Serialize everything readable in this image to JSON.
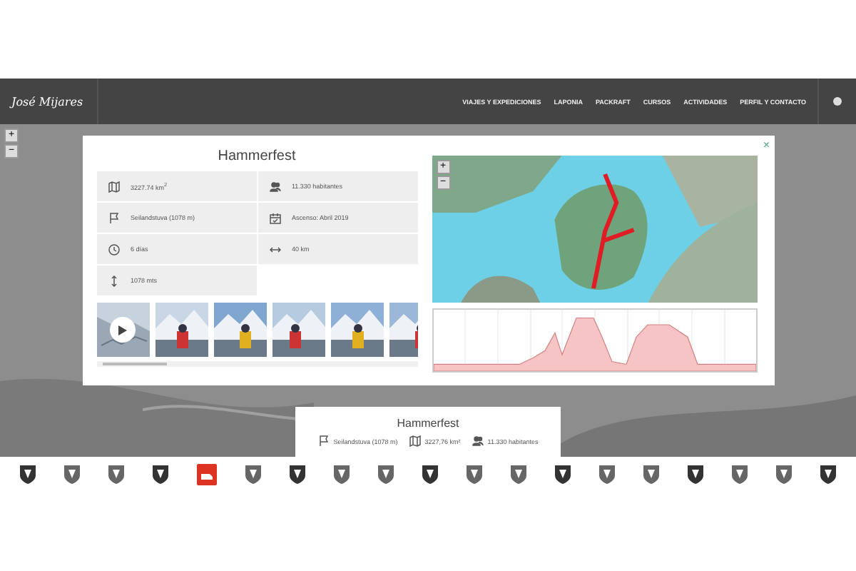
{
  "header": {
    "logo": "José Mijares",
    "nav": [
      {
        "label": "VIAJES Y EXPEDICIONES"
      },
      {
        "label": "LAPONIA"
      },
      {
        "label": "PACKRAFT"
      },
      {
        "label": "CURSOS"
      },
      {
        "label": "ACTIVIDADES"
      },
      {
        "label": "PERFIL Y CONTACTO"
      }
    ]
  },
  "map_controls": [
    "+",
    "−"
  ],
  "modal": {
    "title": "Hammerfest",
    "close": "×",
    "stats": [
      {
        "kind": "area",
        "text": "3227.74 km$^{2}$"
      },
      {
        "kind": "people",
        "text": "11.330 habitantes"
      },
      {
        "kind": "flag",
        "text": "Seilandstuva (1078 m)"
      },
      {
        "kind": "calendar",
        "text": "Ascenso: Abril 2019"
      },
      {
        "kind": "clock",
        "text": "6 días"
      },
      {
        "kind": "distance",
        "text": "40 km"
      },
      {
        "kind": "height",
        "text": "1078 mts"
      }
    ],
    "gallery": [
      {
        "kind": "video"
      },
      {
        "kind": "picture"
      },
      {
        "kind": "picture"
      },
      {
        "kind": "picture"
      },
      {
        "kind": "picture"
      },
      {
        "kind": "picture"
      }
    ],
    "map_zoom": [
      "+",
      "−"
    ]
  },
  "summary": {
    "title": "Hammerfest",
    "items": [
      {
        "kind": "flag",
        "text": "Seilandstuva (1078 m)"
      },
      {
        "kind": "area",
        "text": "3227,76 km²"
      },
      {
        "kind": "people",
        "text": "11.330 habitantes"
      }
    ]
  },
  "shields": [
    {
      "selected": false
    },
    {
      "selected": false
    },
    {
      "selected": false
    },
    {
      "selected": false
    },
    {
      "selected": true
    },
    {
      "selected": false
    },
    {
      "selected": false
    },
    {
      "selected": false
    },
    {
      "selected": false
    },
    {
      "selected": false
    },
    {
      "selected": false
    },
    {
      "selected": false
    },
    {
      "selected": false
    },
    {
      "selected": false
    },
    {
      "selected": false
    },
    {
      "selected": false
    },
    {
      "selected": false
    },
    {
      "selected": false
    },
    {
      "selected": false
    }
  ]
}
